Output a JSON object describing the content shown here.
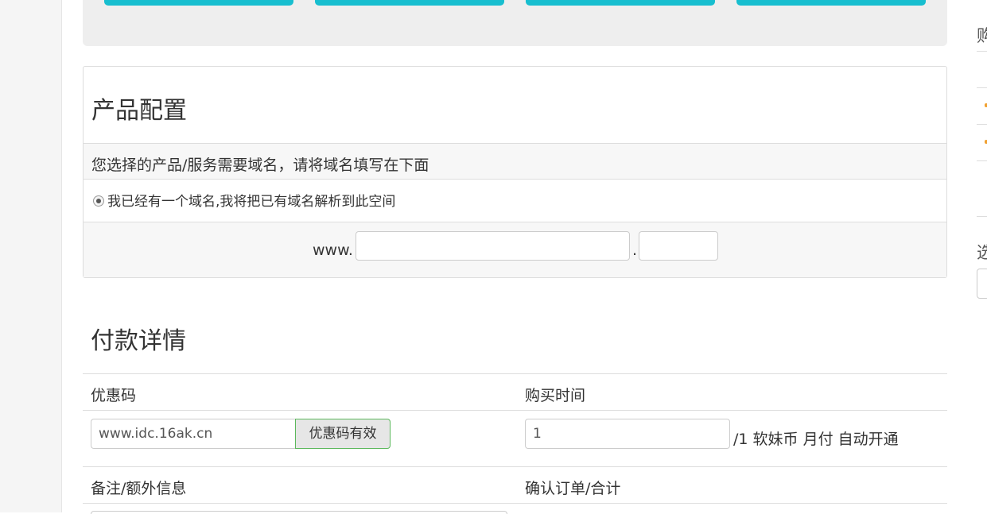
{
  "product_config": {
    "title": "产品配置",
    "hint": "您选择的产品/服务需要域名，请将域名填写在下面",
    "radio_label": "我已经有一个域名,我将把已有域名解析到此空间",
    "www_prefix": "www.",
    "dot": ".",
    "domain_value": "",
    "tld_value": ""
  },
  "payment": {
    "title": "付款详情",
    "coupon_label": "优惠码",
    "coupon_value": "www.idc.16ak.cn",
    "coupon_button": "优惠码有效",
    "period_label": "购买时间",
    "quantity_value": "1",
    "quantity_suffix": "/1 软妹币 月付 自动开通",
    "notes_label": "备注/额外信息",
    "confirm_label": "确认订单/合计"
  },
  "right_column": {
    "char_top": "购",
    "char_mid": "选"
  },
  "colors": {
    "accent_cyan": "#17becf",
    "coupon_valid_border": "#5cb85c",
    "panel_bg": "#eeeeee"
  }
}
